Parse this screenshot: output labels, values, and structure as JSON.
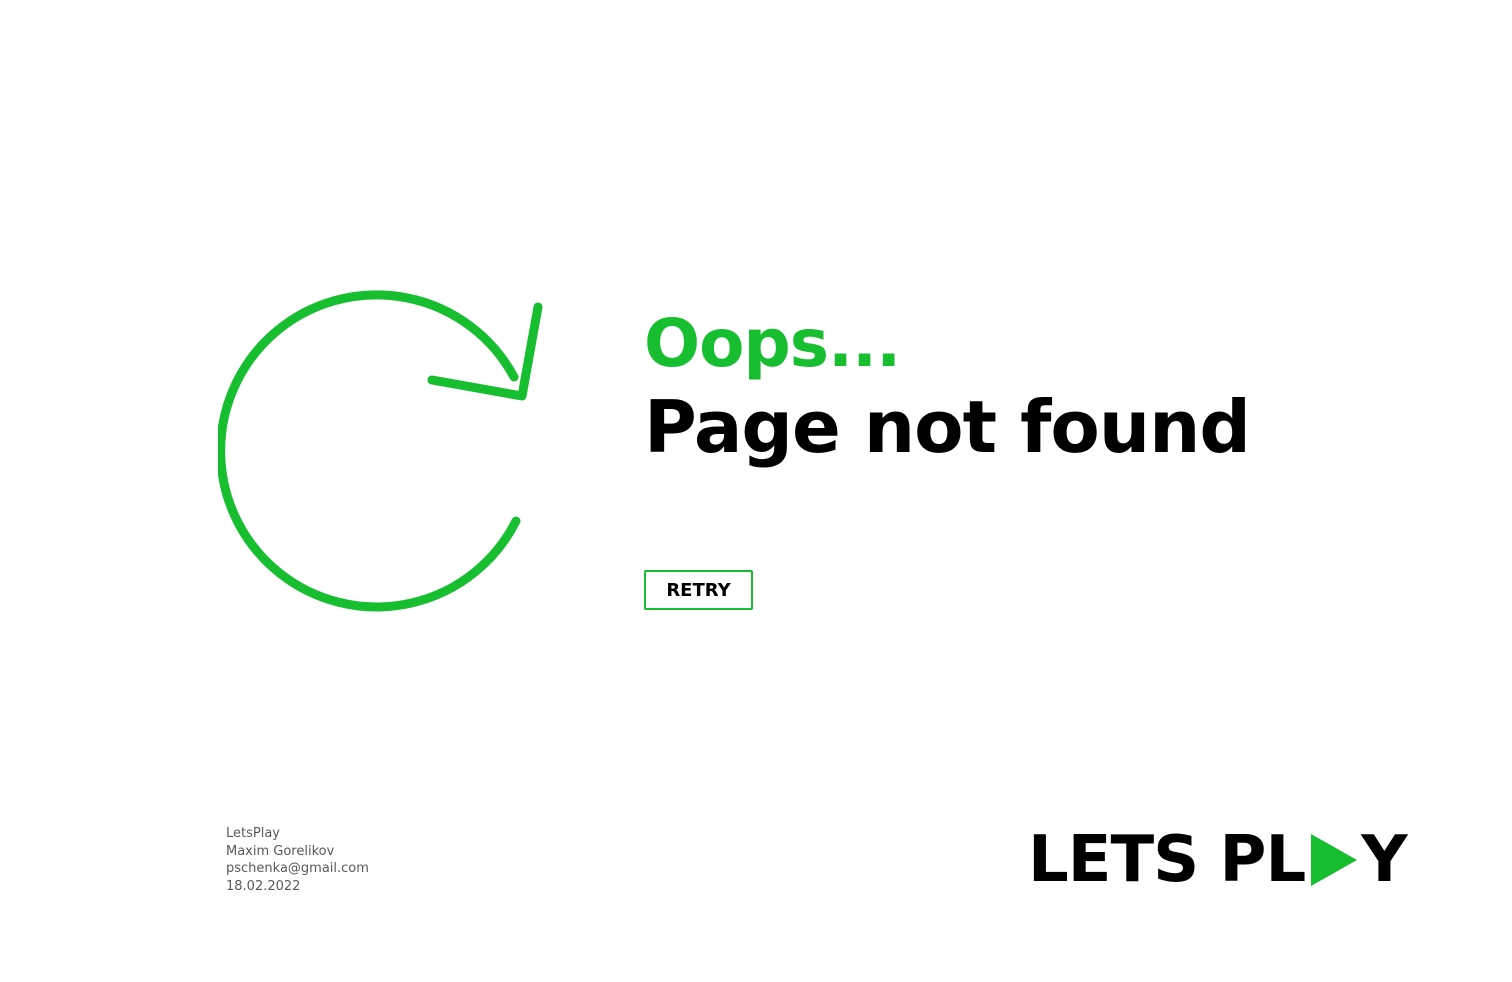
{
  "colors": {
    "accent": "#17BE2F",
    "text": "#000000",
    "muted": "#5a5a5a",
    "background": "#ffffff"
  },
  "icon": {
    "name": "refresh-icon"
  },
  "heading": {
    "oops": "Oops...",
    "title": "Page not found"
  },
  "actions": {
    "retry_label": "RETRY"
  },
  "footer": {
    "app_name": "LetsPlay",
    "author": "Maxim Gorelikov",
    "email": "pschenka@gmail.com",
    "date": "18.02.2022"
  },
  "logo": {
    "text_left": "LETS PL",
    "text_right": "Y",
    "icon": "play-icon"
  }
}
